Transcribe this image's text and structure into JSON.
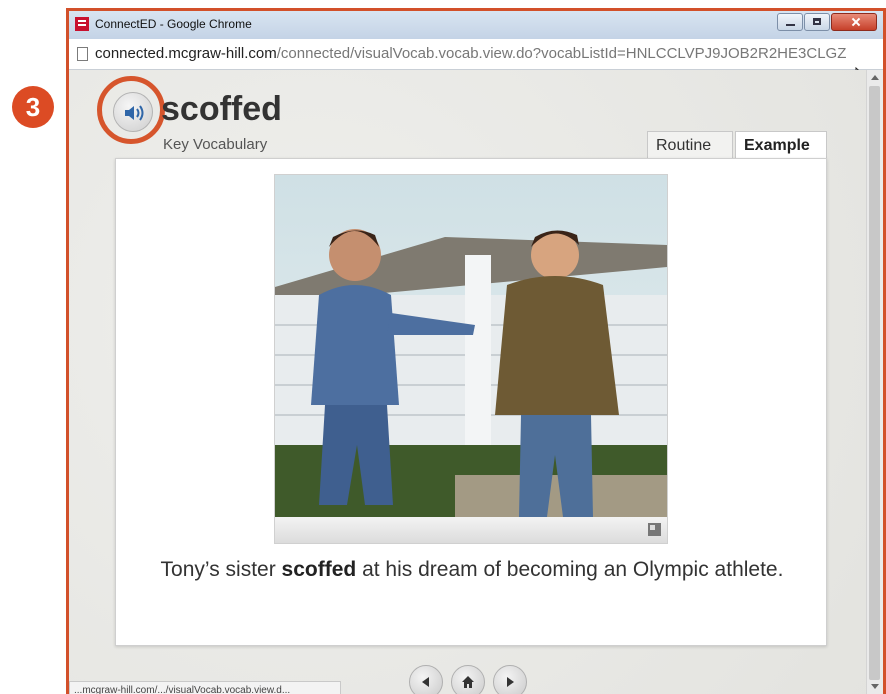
{
  "step_badge": "3",
  "window": {
    "title": "ConnectED - Google Chrome",
    "url_host": "connected.mcgraw-hill.com",
    "url_path": "/connected/visualVocab.vocab.view.do?vocabListId=HNLCCLVPJ9JOB2R2HE3CLGZ"
  },
  "vocab": {
    "word": "scoffed",
    "subtitle": "Key Vocabulary"
  },
  "tabs": [
    {
      "label": "Routine",
      "active": false
    },
    {
      "label": "Example",
      "active": true
    }
  ],
  "caption": {
    "before": "Tony’s sister ",
    "bold": "scoffed",
    "after": " at his dream of becoming an Olympic athlete."
  },
  "status_url": "...mcgraw-hill.com/.../visualVocab.vocab.view.d...",
  "colors": {
    "accent": "#d6552c",
    "badge": "#dc4b24"
  },
  "icons": {
    "audio": "speaker-icon",
    "prev": "arrow-left-icon",
    "home": "home-icon",
    "next": "arrow-right-icon",
    "expand": "expand-icon"
  }
}
